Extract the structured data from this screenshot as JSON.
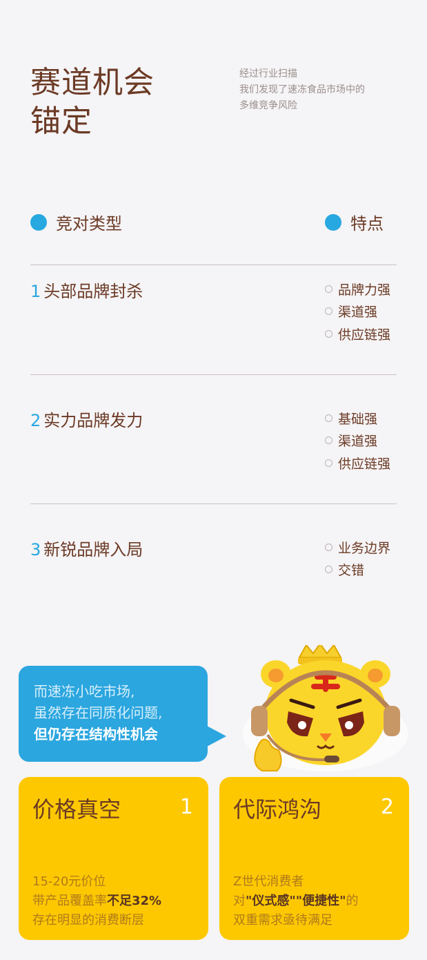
{
  "header": {
    "title_line1": "赛道机会",
    "title_line2": "锚定",
    "subtitle_line1": "经过行业扫描",
    "subtitle_line2": "我们发现了速冻食品市场中的",
    "subtitle_line3": "多维竞争风险"
  },
  "columns": {
    "left": "竞对类型",
    "right": "特点"
  },
  "rows": [
    {
      "num": "1",
      "name": "头部品牌封杀",
      "features": [
        "品牌力强",
        "渠道强",
        "供应链强"
      ]
    },
    {
      "num": "2",
      "name": "实力品牌发力",
      "features": [
        "基础强",
        "渠道强",
        "供应链强"
      ]
    },
    {
      "num": "3",
      "name": "新锐品牌入局",
      "features": [
        "业务边界",
        "交错"
      ]
    }
  ],
  "bubble": {
    "line1": "而速冻小吃市场,",
    "line2": "虽然存在同质化问题,",
    "line3": "但仍存在结构性机会"
  },
  "cards": [
    {
      "title": "价格真空",
      "num": "1",
      "line1": "15-20元价位",
      "line2_pre": "带产品覆盖率",
      "line2_em": "不足32%",
      "line3": "存在明显的消费断层"
    },
    {
      "title": "代际鸿沟",
      "num": "2",
      "line1": "Z世代消费者",
      "line2_pre": "对",
      "line2_em1": "\"仪式感\"",
      "line2_em2": "\"便捷性\"",
      "line2_post": "的",
      "line3": "双重需求亟待满足"
    }
  ],
  "colors": {
    "accent_blue": "#27a8e0",
    "brown_text": "#6b3a25",
    "card_yellow": "#fdc800",
    "background": "#f5f4f6"
  },
  "icons": {
    "header_bullet": "filled-circle-icon",
    "feature_bullet": "ring-icon",
    "mascot": "tiger-mascot-with-headset"
  }
}
